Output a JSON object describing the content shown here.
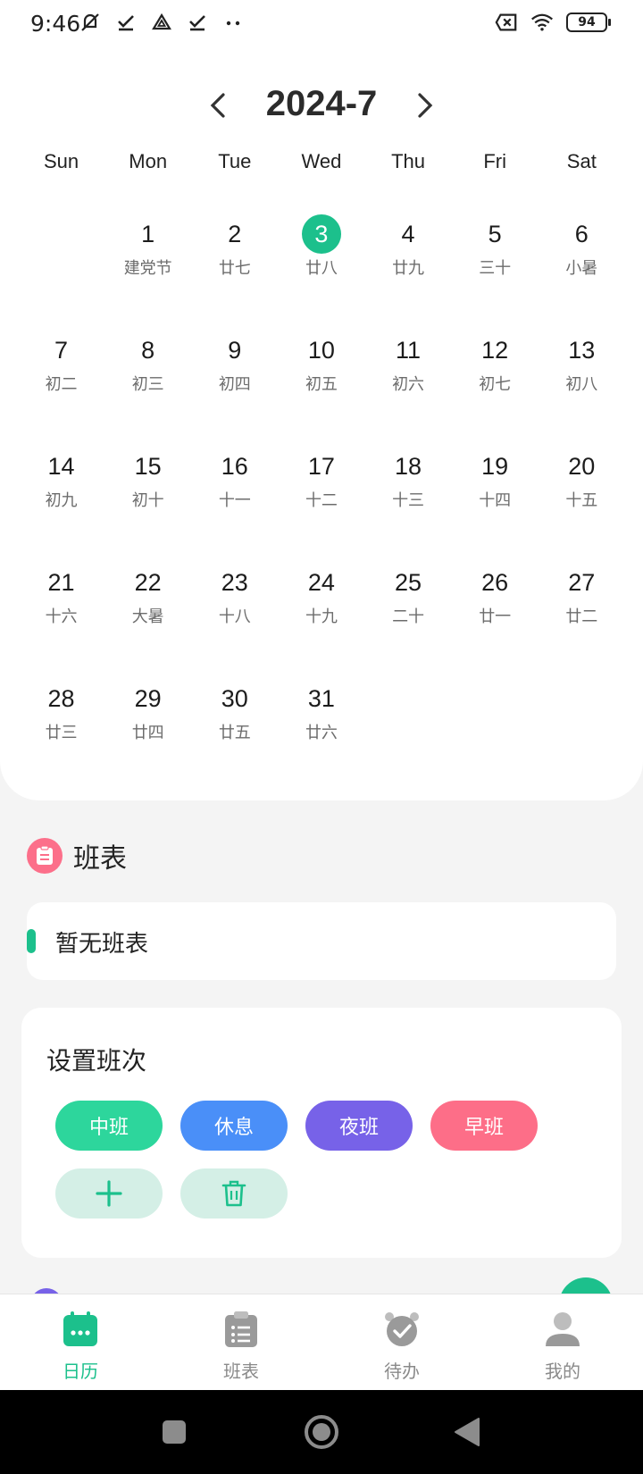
{
  "status_bar": {
    "time": "9:46",
    "left_icons": [
      "mute-icon",
      "check-icon",
      "drive-icon",
      "check-icon",
      "more-dots-icon"
    ],
    "right_icons": [
      "sim-off-icon",
      "wifi-icon"
    ],
    "battery": "94"
  },
  "calendar": {
    "month_title": "2024-7",
    "weekdays": [
      "Sun",
      "Mon",
      "Tue",
      "Wed",
      "Thu",
      "Fri",
      "Sat"
    ],
    "first_weekday_offset": 1,
    "today": 3,
    "accent_color": "#1cc08c",
    "days": [
      {
        "num": "1",
        "lunar": "建党节"
      },
      {
        "num": "2",
        "lunar": "廿七"
      },
      {
        "num": "3",
        "lunar": "廿八"
      },
      {
        "num": "4",
        "lunar": "廿九"
      },
      {
        "num": "5",
        "lunar": "三十"
      },
      {
        "num": "6",
        "lunar": "小暑"
      },
      {
        "num": "7",
        "lunar": "初二"
      },
      {
        "num": "8",
        "lunar": "初三"
      },
      {
        "num": "9",
        "lunar": "初四"
      },
      {
        "num": "10",
        "lunar": "初五"
      },
      {
        "num": "11",
        "lunar": "初六"
      },
      {
        "num": "12",
        "lunar": "初七"
      },
      {
        "num": "13",
        "lunar": "初八"
      },
      {
        "num": "14",
        "lunar": "初九"
      },
      {
        "num": "15",
        "lunar": "初十"
      },
      {
        "num": "16",
        "lunar": "十一"
      },
      {
        "num": "17",
        "lunar": "十二"
      },
      {
        "num": "18",
        "lunar": "十三"
      },
      {
        "num": "19",
        "lunar": "十四"
      },
      {
        "num": "20",
        "lunar": "十五"
      },
      {
        "num": "21",
        "lunar": "十六"
      },
      {
        "num": "22",
        "lunar": "大暑"
      },
      {
        "num": "23",
        "lunar": "十八"
      },
      {
        "num": "24",
        "lunar": "十九"
      },
      {
        "num": "25",
        "lunar": "二十"
      },
      {
        "num": "26",
        "lunar": "廿一"
      },
      {
        "num": "27",
        "lunar": "廿二"
      },
      {
        "num": "28",
        "lunar": "廿三"
      },
      {
        "num": "29",
        "lunar": "廿四"
      },
      {
        "num": "30",
        "lunar": "廿五"
      },
      {
        "num": "31",
        "lunar": "廿六"
      }
    ]
  },
  "schedule": {
    "title": "班表",
    "empty_text": "暂无班表"
  },
  "shift_settings": {
    "title": "设置班次",
    "shifts": [
      {
        "label": "中班",
        "color": "#2dd69c"
      },
      {
        "label": "休息",
        "color": "#4a8ff8"
      },
      {
        "label": "夜班",
        "color": "#7762e8"
      },
      {
        "label": "早班",
        "color": "#fd6e88"
      }
    ],
    "add_icon": "plus-icon",
    "delete_icon": "trash-icon"
  },
  "tabbar": {
    "tabs": [
      {
        "label": "日历",
        "icon": "calendar-icon",
        "active": true
      },
      {
        "label": "班表",
        "icon": "clipboard-icon",
        "active": false
      },
      {
        "label": "待办",
        "icon": "alarm-clock-icon",
        "active": false
      },
      {
        "label": "我的",
        "icon": "user-icon",
        "active": false
      }
    ]
  }
}
